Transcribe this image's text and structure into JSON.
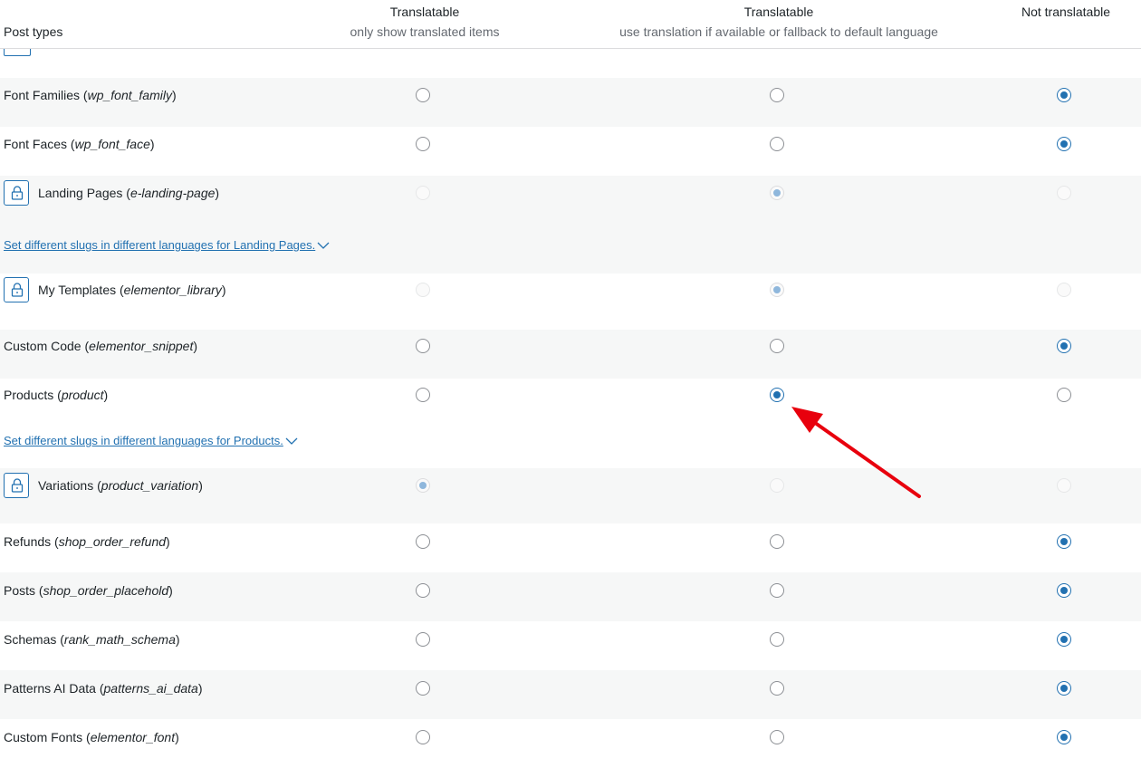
{
  "header": {
    "post_types": "Post types",
    "col1_title": "Translatable",
    "col1_sub": "only show translated items",
    "col2_title": "Translatable",
    "col2_sub": "use translation if available or fallback to default language",
    "col3_title": "Not translatable"
  },
  "rows": [
    {
      "name": "Font Families",
      "slug": "wp_font_family",
      "locked": false,
      "selected": 3
    },
    {
      "name": "Font Faces",
      "slug": "wp_font_face",
      "locked": false,
      "selected": 3
    },
    {
      "name": "Landing Pages",
      "slug": "e-landing-page",
      "locked": true,
      "selected": 2,
      "slugs_link": "Set different slugs in different languages for Landing Pages."
    },
    {
      "name": "My Templates",
      "slug": "elementor_library",
      "locked": true,
      "selected": 2
    },
    {
      "name": "Custom Code",
      "slug": "elementor_snippet",
      "locked": false,
      "selected": 3
    },
    {
      "name": "Products",
      "slug": "product",
      "locked": false,
      "selected": 2,
      "slugs_link": "Set different slugs in different languages for Products."
    },
    {
      "name": "Variations",
      "slug": "product_variation",
      "locked": true,
      "selected": 1
    },
    {
      "name": "Refunds",
      "slug": "shop_order_refund",
      "locked": false,
      "selected": 3
    },
    {
      "name": "Posts",
      "slug": "shop_order_placehold",
      "locked": false,
      "selected": 3
    },
    {
      "name": "Schemas",
      "slug": "rank_math_schema",
      "locked": false,
      "selected": 3
    },
    {
      "name": "Patterns AI Data",
      "slug": "patterns_ai_data",
      "locked": false,
      "selected": 3
    },
    {
      "name": "Custom Fonts",
      "slug": "elementor_font",
      "locked": false,
      "selected": 3
    }
  ],
  "colors": {
    "accent": "#2271b1",
    "stripe": "#f6f7f7",
    "arrow": "#e8000d"
  },
  "icons": {
    "lock": "lock-icon",
    "chevron": "chevron-down-icon",
    "annotation": "red-arrow"
  }
}
